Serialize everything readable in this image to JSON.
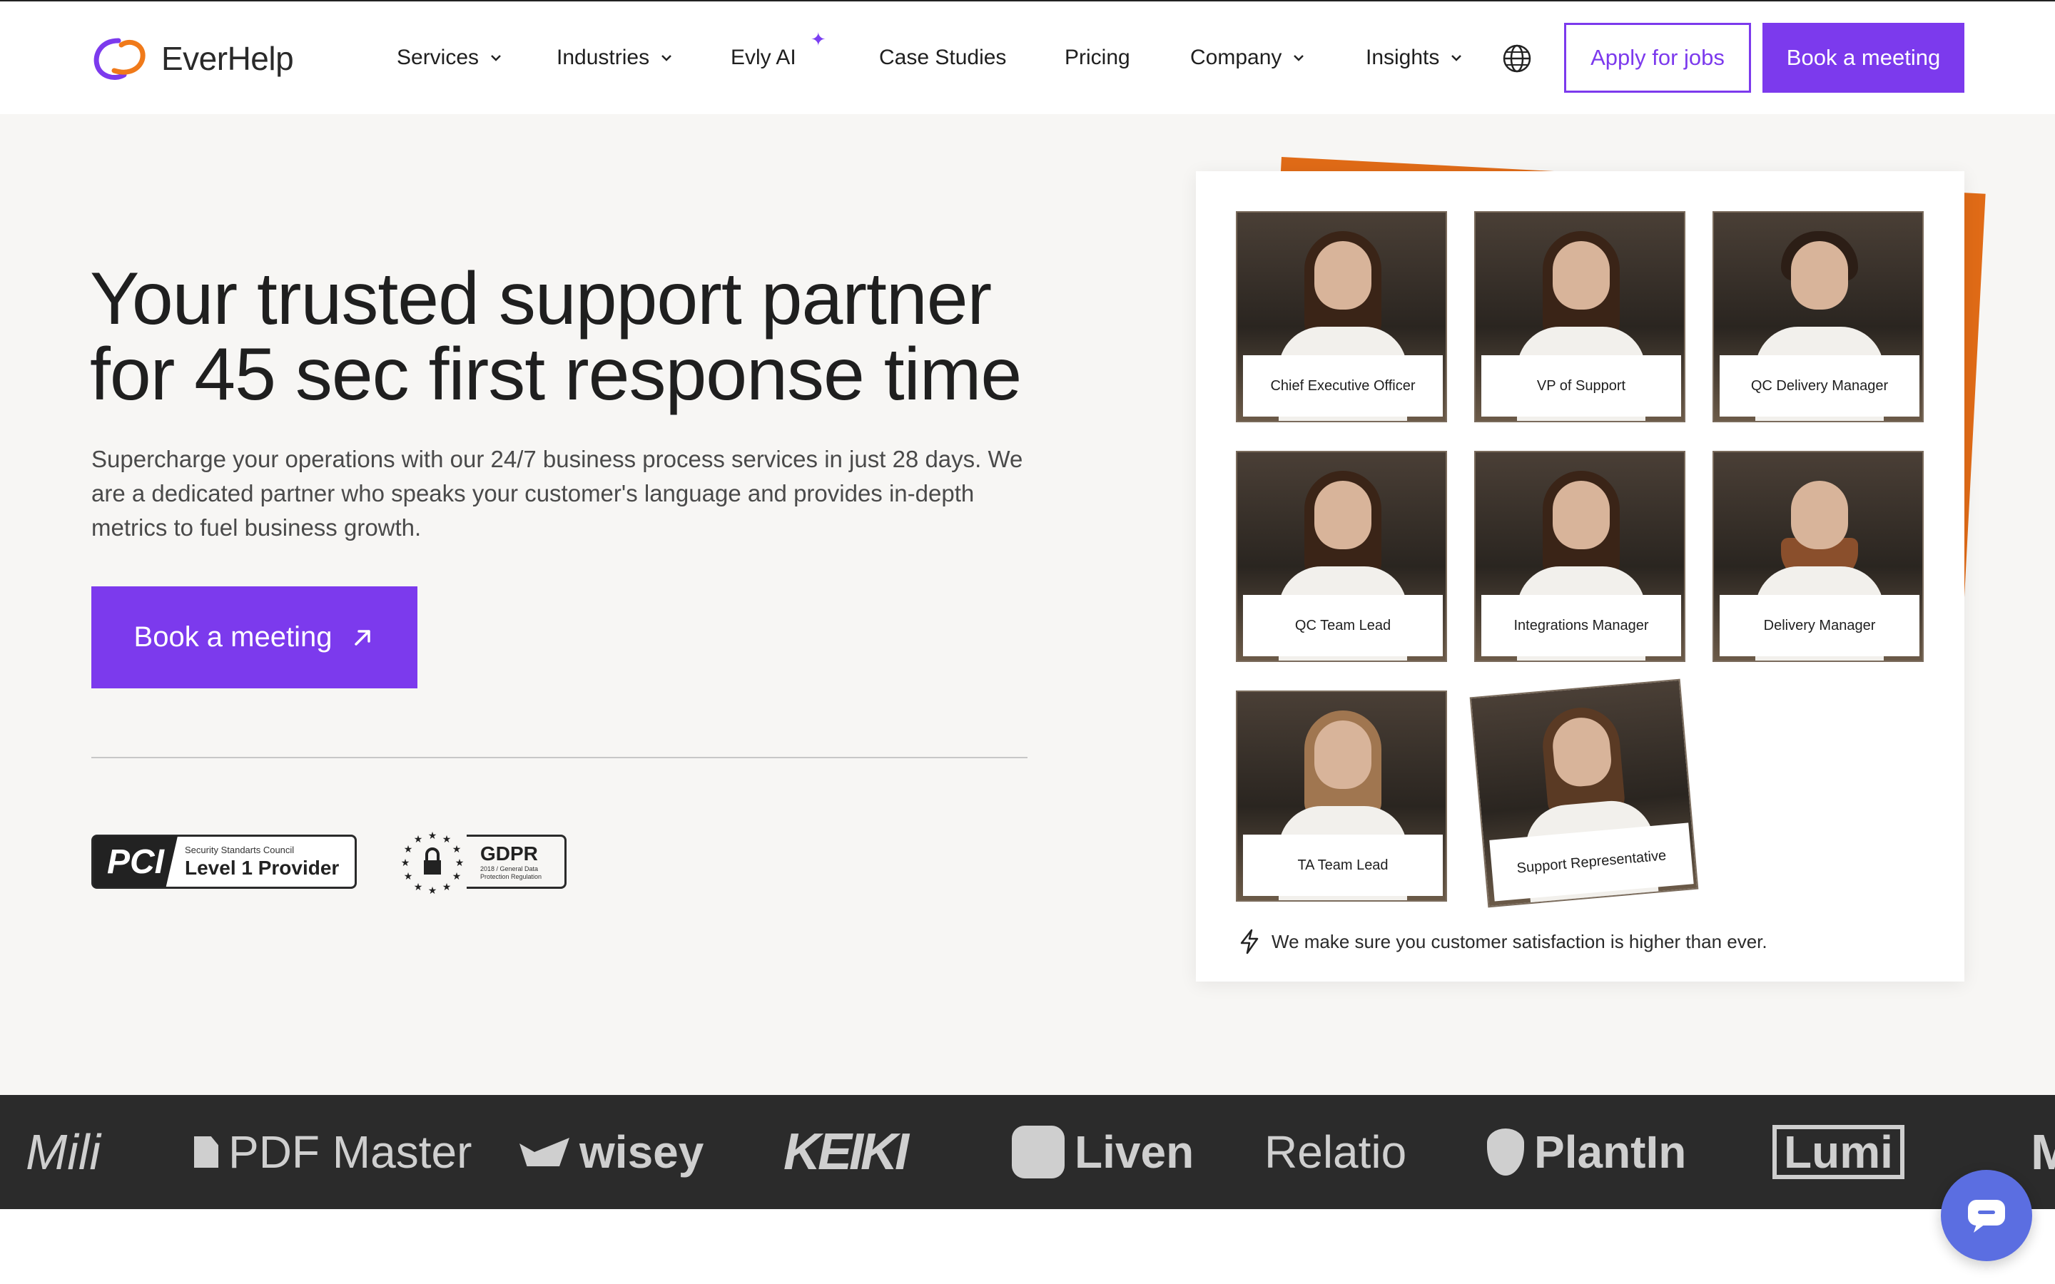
{
  "brand": {
    "name": "EverHelp"
  },
  "nav": {
    "items": [
      {
        "label": "Services",
        "dropdown": true
      },
      {
        "label": "Industries",
        "dropdown": true
      },
      {
        "label": "Evly AI",
        "dropdown": false
      },
      {
        "label": "Case Studies",
        "dropdown": false
      },
      {
        "label": "Pricing",
        "dropdown": false
      },
      {
        "label": "Company",
        "dropdown": true
      },
      {
        "label": "Insights",
        "dropdown": true
      }
    ],
    "apply_label": "Apply for jobs",
    "book_label": "Book a meeting"
  },
  "hero": {
    "title_line1": "Your trusted support partner",
    "title_line2": "for 45 sec first response time",
    "subtitle": "Supercharge your operations with our 24/7 business process services in just 28 days. We are a dedicated partner who speaks your customer's language and provides in-depth metrics to fuel business growth.",
    "cta_label": "Book a meeting"
  },
  "badges": {
    "pci_mark": "PCI",
    "pci_small": "Security Standarts Council",
    "pci_big": "Level 1 Provider",
    "gdpr_big": "GDPR",
    "gdpr_small": "2018 / General Data Protection Regulation"
  },
  "team": {
    "members": [
      {
        "role": "Chief Executive Officer"
      },
      {
        "role": "VP of Support"
      },
      {
        "role": "QC Delivery Manager"
      },
      {
        "role": "QC Team Lead"
      },
      {
        "role": "Integrations Manager"
      },
      {
        "role": "Delivery Manager"
      },
      {
        "role": "TA Team Lead"
      },
      {
        "role": "Support Representative"
      }
    ],
    "note": "We make sure you customer satisfaction is higher than ever."
  },
  "client_logos": [
    "Mili",
    "PDF Master",
    "wisey",
    "KEIKI",
    "Liven",
    "Relatio",
    "PlantIn",
    "Lumi"
  ],
  "colors": {
    "accent": "#7c3aed",
    "orange": "#e06b17",
    "logo_strip_bg": "#2b2b2b",
    "chat": "#5b6ee1"
  }
}
